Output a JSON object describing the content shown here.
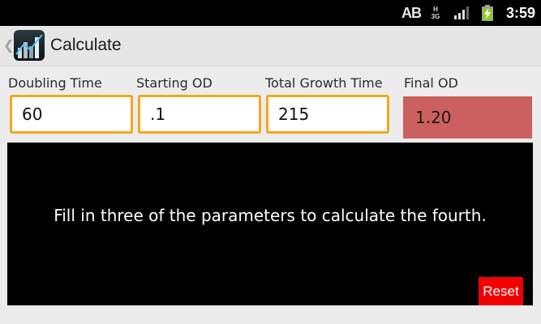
{
  "status_bar": {
    "ab_label": "AB",
    "network_h": "H",
    "network_3g": "3G",
    "time": "3:59"
  },
  "action_bar": {
    "title": "Calculate",
    "up_caret": "❮"
  },
  "form": {
    "doubling_time": {
      "label": "Doubling Time",
      "value": "60"
    },
    "starting_od": {
      "label": "Starting OD",
      "value": ".1"
    },
    "total_growth_time": {
      "label": "Total Growth Time",
      "value": "215"
    },
    "final_od": {
      "label": "Final OD",
      "value": "1.20"
    }
  },
  "message": "Fill in three of the parameters to calculate the fourth.",
  "reset_label": "Reset",
  "colors": {
    "input_border": "#f2a81e",
    "result_background": "#cc5f5f",
    "reset_background": "#f20000"
  }
}
